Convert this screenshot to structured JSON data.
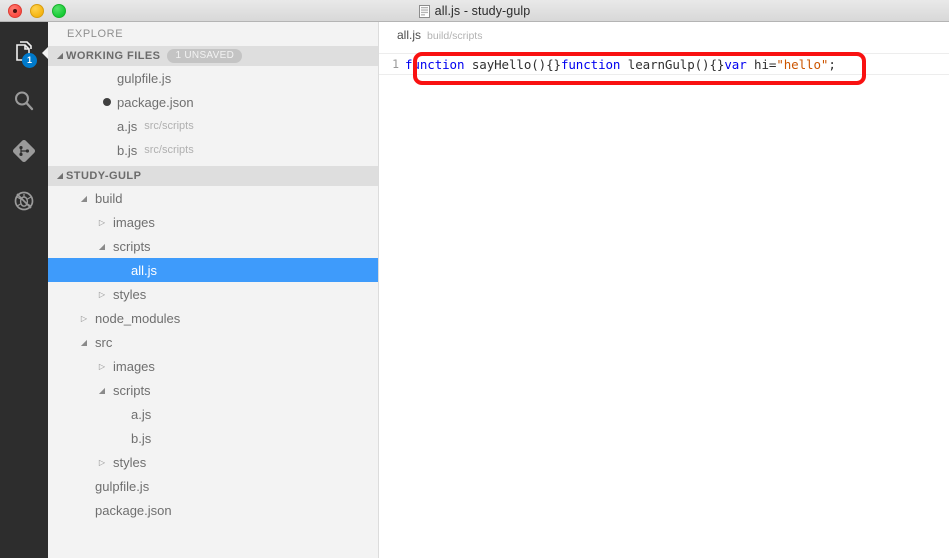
{
  "titlebar": {
    "title": "all.js - study-gulp",
    "doc_icon": "document-icon",
    "buttons": {
      "close": "close-button",
      "minimize": "minimize-button",
      "maximize": "maximize-button"
    }
  },
  "activitybar": {
    "items": [
      {
        "icon": "files-icon",
        "badge": "1",
        "active": true
      },
      {
        "icon": "search-icon",
        "badge": "",
        "active": false
      },
      {
        "icon": "source-control-icon",
        "badge": "",
        "active": false
      },
      {
        "icon": "debug-icon",
        "badge": "",
        "active": false
      }
    ]
  },
  "sidebar": {
    "explore_label": "EXPLORE",
    "working_files": {
      "label": "WORKING FILES",
      "badge": "1 UNSAVED",
      "twisty": "◢",
      "items": [
        {
          "name": "gulpfile.js",
          "path": "",
          "dirty": false
        },
        {
          "name": "package.json",
          "path": "",
          "dirty": true
        },
        {
          "name": "a.js",
          "path": "src/scripts",
          "dirty": false
        },
        {
          "name": "b.js",
          "path": "src/scripts",
          "dirty": false
        }
      ]
    },
    "folder": {
      "label": "STUDY-GULP",
      "twisty": "◢",
      "tree": [
        {
          "name": "build",
          "indent": 1,
          "kind": "folder",
          "expanded": true,
          "selected": false
        },
        {
          "name": "images",
          "indent": 2,
          "kind": "folder",
          "expanded": false,
          "selected": false
        },
        {
          "name": "scripts",
          "indent": 2,
          "kind": "folder",
          "expanded": true,
          "selected": false
        },
        {
          "name": "all.js",
          "indent": 3,
          "kind": "file",
          "expanded": false,
          "selected": true
        },
        {
          "name": "styles",
          "indent": 2,
          "kind": "folder",
          "expanded": false,
          "selected": false
        },
        {
          "name": "node_modules",
          "indent": 1,
          "kind": "folder",
          "expanded": false,
          "selected": false
        },
        {
          "name": "src",
          "indent": 1,
          "kind": "folder",
          "expanded": true,
          "selected": false
        },
        {
          "name": "images",
          "indent": 2,
          "kind": "folder",
          "expanded": false,
          "selected": false
        },
        {
          "name": "scripts",
          "indent": 2,
          "kind": "folder",
          "expanded": true,
          "selected": false
        },
        {
          "name": "a.js",
          "indent": 3,
          "kind": "file",
          "expanded": false,
          "selected": false
        },
        {
          "name": "b.js",
          "indent": 3,
          "kind": "file",
          "expanded": false,
          "selected": false
        },
        {
          "name": "styles",
          "indent": 2,
          "kind": "folder",
          "expanded": false,
          "selected": false
        },
        {
          "name": "gulpfile.js",
          "indent": 1,
          "kind": "file",
          "expanded": false,
          "selected": false
        },
        {
          "name": "package.json",
          "indent": 1,
          "kind": "file",
          "expanded": false,
          "selected": false
        }
      ]
    }
  },
  "editor": {
    "breadcrumb_file": "all.js",
    "breadcrumb_path": "build/scripts",
    "line_number": "1",
    "code_tokens": [
      {
        "t": "function ",
        "c": "kw"
      },
      {
        "t": "sayHello(){}",
        "c": "pl"
      },
      {
        "t": "function ",
        "c": "kw"
      },
      {
        "t": "learnGulp(){}",
        "c": "pl"
      },
      {
        "t": "var ",
        "c": "kw"
      },
      {
        "t": "hi=",
        "c": "pl"
      },
      {
        "t": "\"hello\"",
        "c": "str"
      },
      {
        "t": ";",
        "c": "pl"
      }
    ]
  },
  "annotation": {
    "name": "red-highlight-box",
    "color": "#f91111"
  },
  "colors": {
    "accent_selection": "#3e9bfb",
    "badge_blue": "#007acc",
    "activitybar_bg": "#2d2d2d",
    "sidebar_bg": "#f3f3f3",
    "section_header_bg": "#dedede",
    "keyword": "#0000f0",
    "string": "#cc5500",
    "annotation_red": "#f91111"
  }
}
